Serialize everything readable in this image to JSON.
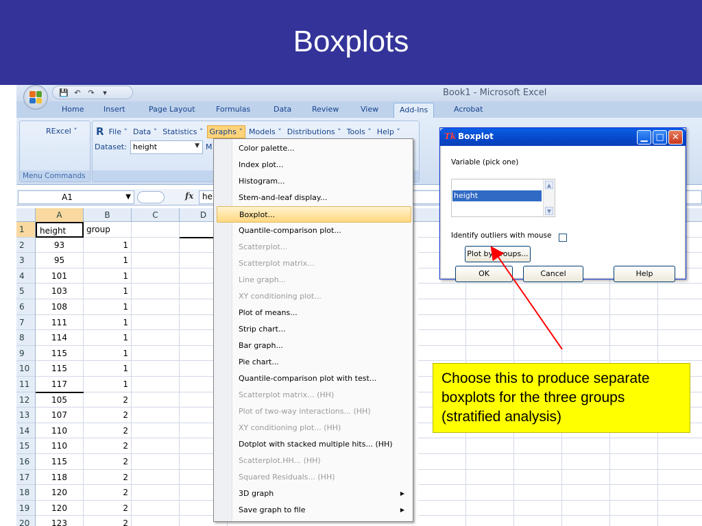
{
  "slide": {
    "title": "Boxplots"
  },
  "app": {
    "window_title": "Book1 - Microsoft Excel"
  },
  "quick_access": [
    "save-icon",
    "undo-icon",
    "redo-icon",
    "customize-icon"
  ],
  "ribbon_tabs": [
    "Home",
    "Insert",
    "Page Layout",
    "Formulas",
    "Data",
    "Review",
    "View",
    "Add-Ins",
    "Acrobat"
  ],
  "active_tab": "Add-Ins",
  "rexcel": {
    "menu_label": "RExcel ˅",
    "group_caption": "Menu Commands",
    "menus": [
      "File ˅",
      "Data ˅",
      "Statistics ˅",
      "Graphs ˅",
      "Models ˅",
      "Distributions ˅",
      "Tools ˅",
      "Help ˅"
    ],
    "dataset_label": "Dataset:",
    "dataset_value": "height",
    "dataset_trailing": "M"
  },
  "formula_bar": {
    "name_box": "A1",
    "fx": "fx",
    "value": "he"
  },
  "columns": [
    "A",
    "B",
    "C",
    "D"
  ],
  "rows": [
    {
      "n": "1",
      "a": "height",
      "b": "group"
    },
    {
      "n": "2",
      "a": "93",
      "b": "1"
    },
    {
      "n": "3",
      "a": "95",
      "b": "1"
    },
    {
      "n": "4",
      "a": "101",
      "b": "1"
    },
    {
      "n": "5",
      "a": "103",
      "b": "1"
    },
    {
      "n": "6",
      "a": "108",
      "b": "1"
    },
    {
      "n": "7",
      "a": "111",
      "b": "1"
    },
    {
      "n": "8",
      "a": "114",
      "b": "1"
    },
    {
      "n": "9",
      "a": "115",
      "b": "1"
    },
    {
      "n": "10",
      "a": "115",
      "b": "1"
    },
    {
      "n": "11",
      "a": "117",
      "b": "1"
    },
    {
      "n": "12",
      "a": "105",
      "b": "2"
    },
    {
      "n": "13",
      "a": "107",
      "b": "2"
    },
    {
      "n": "14",
      "a": "110",
      "b": "2"
    },
    {
      "n": "15",
      "a": "110",
      "b": "2"
    },
    {
      "n": "16",
      "a": "115",
      "b": "2"
    },
    {
      "n": "17",
      "a": "118",
      "b": "2"
    },
    {
      "n": "18",
      "a": "120",
      "b": "2"
    },
    {
      "n": "19",
      "a": "120",
      "b": "2"
    },
    {
      "n": "20",
      "a": "123",
      "b": "2"
    }
  ],
  "graphs_menu": [
    {
      "label": "Color palette...",
      "disabled": false
    },
    {
      "label": "Index plot...",
      "disabled": false
    },
    {
      "label": "Histogram...",
      "disabled": false
    },
    {
      "label": "Stem-and-leaf display...",
      "disabled": false
    },
    {
      "label": "Boxplot...",
      "disabled": false,
      "highlighted": true
    },
    {
      "label": "Quantile-comparison plot...",
      "disabled": false
    },
    {
      "label": "Scatterplot...",
      "disabled": true
    },
    {
      "label": "Scatterplot matrix...",
      "disabled": true
    },
    {
      "label": "Line graph...",
      "disabled": true
    },
    {
      "label": "XY conditioning plot...",
      "disabled": true
    },
    {
      "label": "Plot of means...",
      "disabled": false
    },
    {
      "label": "Strip chart...",
      "disabled": false
    },
    {
      "label": "Bar graph...",
      "disabled": false
    },
    {
      "label": "Pie chart...",
      "disabled": false
    },
    {
      "label": "Quantile-comparison plot with test...",
      "disabled": false
    },
    {
      "label": "Scatterplot matrix... (HH)",
      "disabled": true
    },
    {
      "label": "Plot of two-way interactions... (HH)",
      "disabled": true
    },
    {
      "label": "XY conditioning plot... (HH)",
      "disabled": true
    },
    {
      "label": "Dotplot with stacked multiple hits... (HH)",
      "disabled": false
    },
    {
      "label": "Scatterplot.HH... (HH)",
      "disabled": true
    },
    {
      "label": "Squared Residuals... (HH)",
      "disabled": true
    },
    {
      "label": "3D graph",
      "disabled": false,
      "submenu": true
    },
    {
      "label": "Save graph to file",
      "disabled": false,
      "submenu": true
    }
  ],
  "dialog": {
    "title_icon": "Tk",
    "title": "Boxplot",
    "variable_label": "Variable (pick one)",
    "list_items": [
      "height"
    ],
    "identify_label": "Identify outliers with mouse",
    "identify_checked": false,
    "plot_by_groups": "Plot by groups...",
    "ok": "OK",
    "cancel": "Cancel",
    "help": "Help"
  },
  "annotation": {
    "text": "Choose this to produce separate boxplots for the three groups (stratified analysis)",
    "background": "#ffff00",
    "arrow_color": "#ff0000"
  },
  "colors": {
    "banner": "#333399",
    "ribbon": "#d0def2",
    "menu_highlight": "#ffd77f",
    "dialog_titlebar": "#0748c9"
  }
}
